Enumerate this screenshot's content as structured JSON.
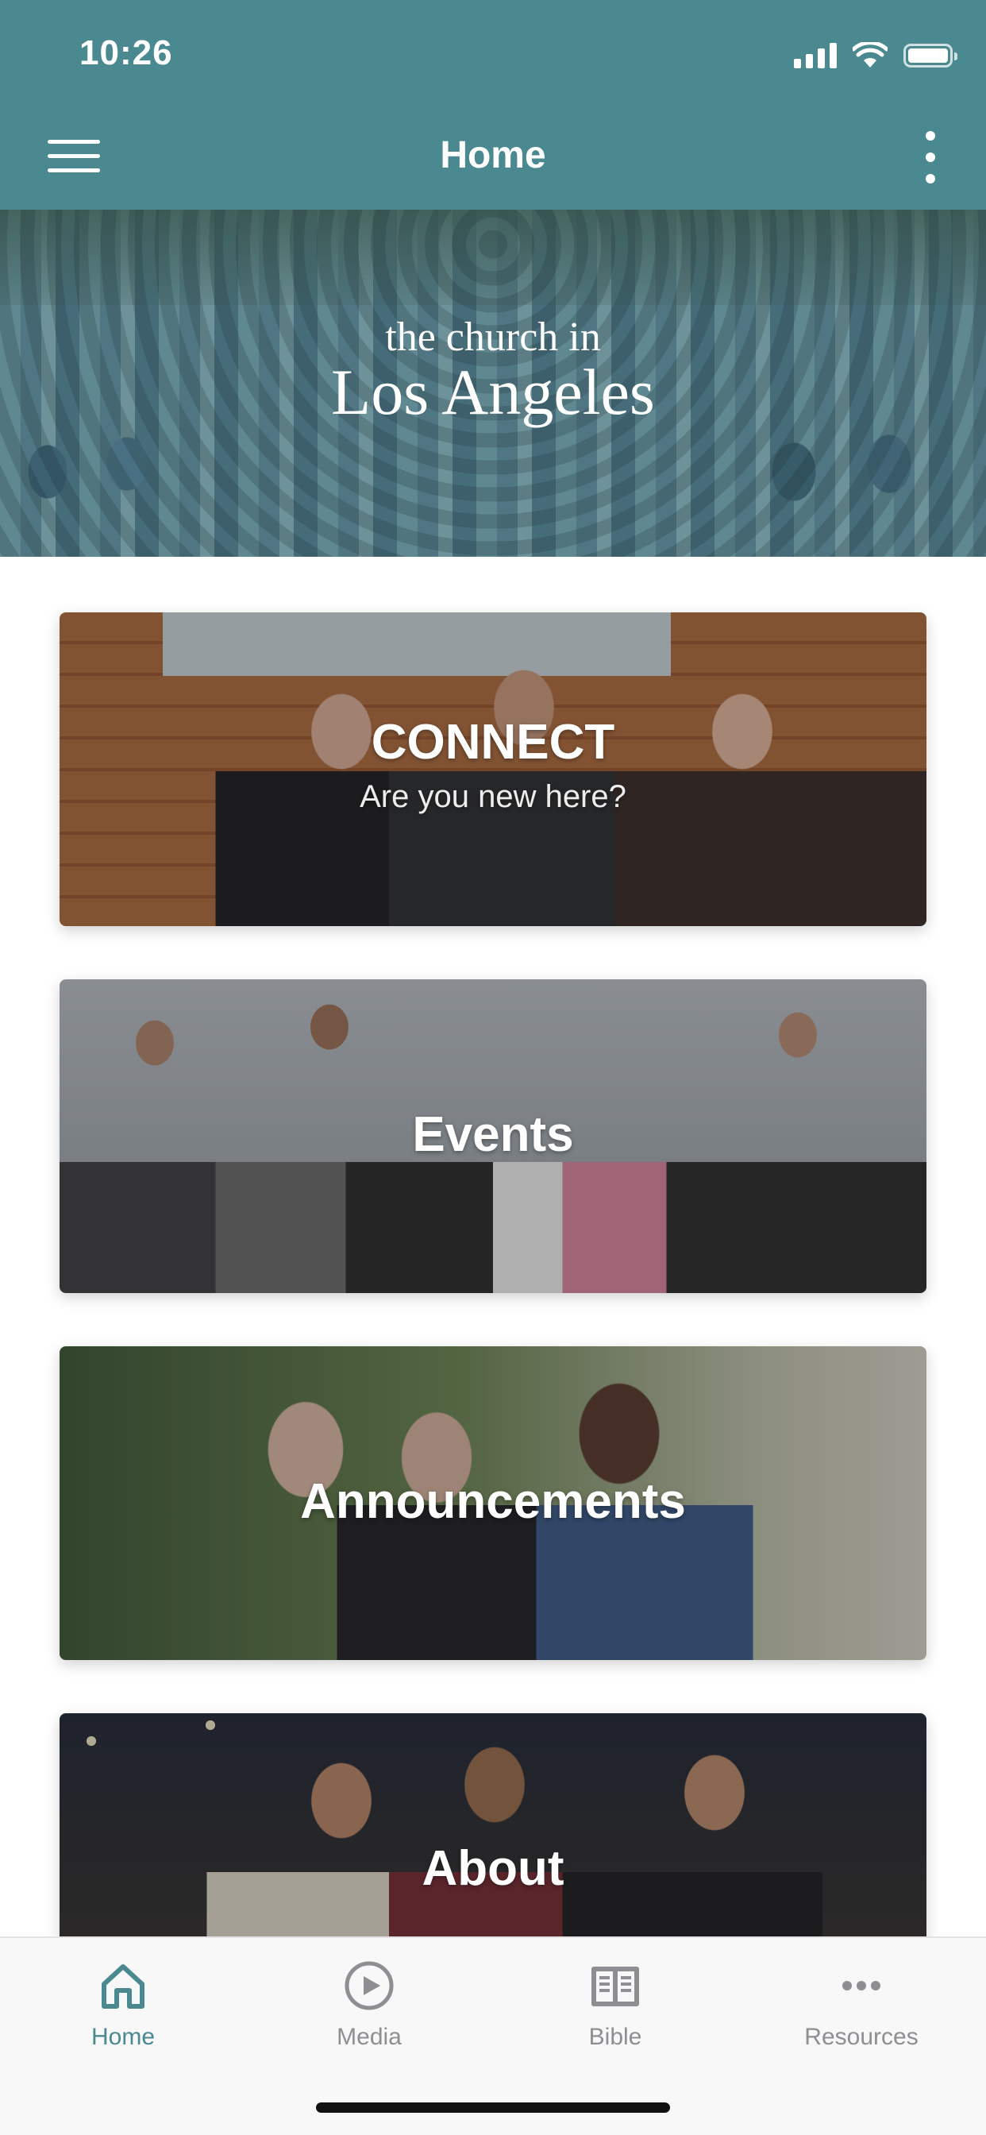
{
  "status_bar": {
    "time": "10:26"
  },
  "app_bar": {
    "title": "Home",
    "menu_icon": "hamburger-menu-icon",
    "more_icon": "vertical-ellipsis-icon"
  },
  "hero": {
    "logo_line1": "the church in",
    "logo_line2": "Los Angeles"
  },
  "cards": [
    {
      "title": "CONNECT",
      "subtitle": "Are you new here?"
    },
    {
      "title": "Events"
    },
    {
      "title": "Announcements"
    },
    {
      "title": "About"
    }
  ],
  "tabs": [
    {
      "label": "Home",
      "icon": "home-icon",
      "active": true
    },
    {
      "label": "Media",
      "icon": "play-circle-icon",
      "active": false
    },
    {
      "label": "Bible",
      "icon": "open-book-icon",
      "active": false
    },
    {
      "label": "Resources",
      "icon": "ellipsis-icon",
      "active": false
    }
  ],
  "colors": {
    "primary": "#4a8990",
    "tab_inactive": "#8e8e93",
    "tab_bar_bg": "#f8f8f8"
  }
}
